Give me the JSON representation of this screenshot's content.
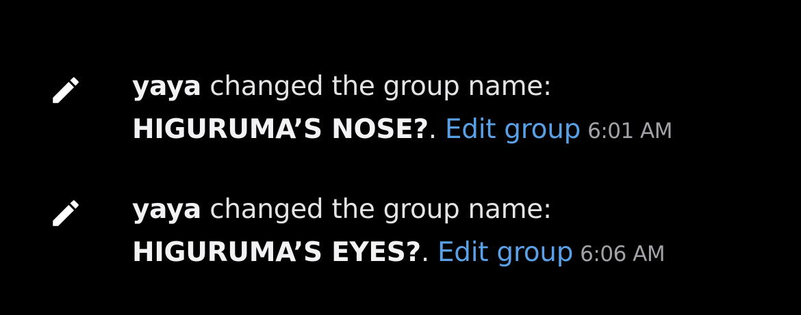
{
  "colors": {
    "background": "#000000",
    "text": "#e4e4e6",
    "link": "#5aa0e6",
    "timestamp": "#a2a2a8",
    "icon": "#ffffff"
  },
  "events": [
    {
      "icon": "pencil-icon",
      "author": "yaya",
      "action": "changed the group name:",
      "group_name": "HIGURUMA’S NOSE?",
      "period": ".",
      "link": "Edit group",
      "time": "6:01 AM"
    },
    {
      "icon": "pencil-icon",
      "author": "yaya",
      "action": "changed the group name:",
      "group_name": "HIGURUMA’S EYES?",
      "period": ".",
      "link": "Edit group",
      "time": "6:06 AM"
    }
  ]
}
